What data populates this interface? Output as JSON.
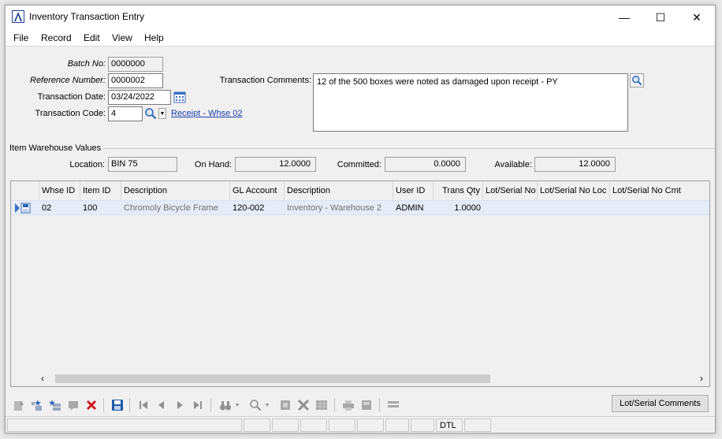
{
  "window": {
    "title": "Inventory Transaction Entry",
    "minimize": "—",
    "maximize": "☐",
    "close": "✕"
  },
  "menu": [
    "File",
    "Record",
    "Edit",
    "View",
    "Help"
  ],
  "header": {
    "batch_no_label": "Batch No:",
    "batch_no": "0000000",
    "reference_label": "Reference Number:",
    "reference": "0000002",
    "date_label": "Transaction Date:",
    "date": "03/24/2022",
    "code_label": "Transaction Code:",
    "code": "4",
    "code_link": "Receipt - Whse 02",
    "comments_label": "Transaction Comments:",
    "comments": "12 of the 500 boxes were noted as damaged upon receipt - PY"
  },
  "warehouse": {
    "group_label": "Item Warehouse Values",
    "location_label": "Location:",
    "location": "BIN 75",
    "on_hand_label": "On Hand:",
    "on_hand": "12.0000",
    "committed_label": "Committed:",
    "committed": "0.0000",
    "available_label": "Available:",
    "available": "12.0000"
  },
  "grid": {
    "columns": [
      "Whse ID",
      "Item ID",
      "Description",
      "GL Account",
      "Description",
      "User ID",
      "Trans Qty",
      "Lot/Serial No",
      "Lot/Serial No Loc",
      "Lot/Serial No Cmt"
    ],
    "rows": [
      [
        "02",
        "100",
        "Chromoly Bicycle Frame",
        "120-002",
        "Inventory - Warehouse 2",
        "ADMIN",
        "1.0000",
        "",
        "",
        ""
      ]
    ]
  },
  "buttons": {
    "lot_serial_comments": "Lot/Serial Comments"
  },
  "status": {
    "mode": "DTL"
  },
  "colors": {
    "link": "#1a3fae",
    "row_selected": "#e5ecf7",
    "delete": "#d01818",
    "save": "#1e5aa8"
  }
}
